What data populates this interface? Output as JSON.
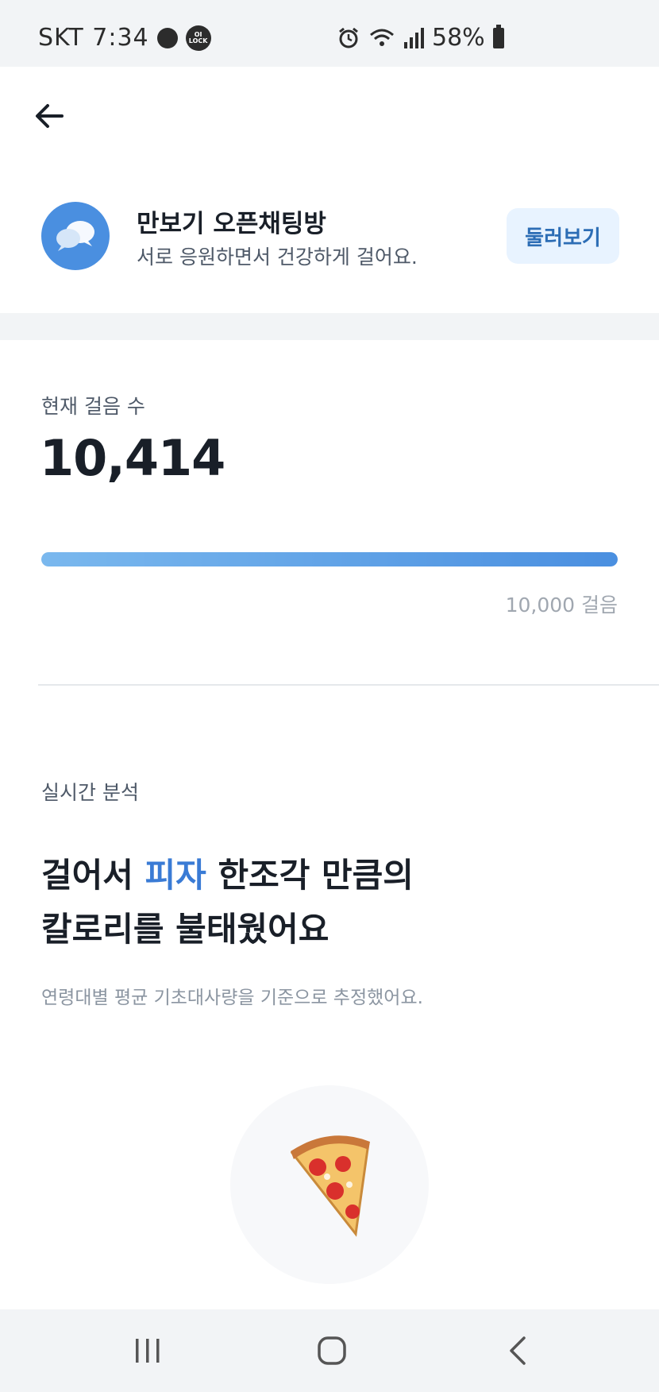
{
  "status_bar": {
    "carrier_time": "SKT 7:34",
    "lock_badge": "OI LOCK",
    "battery_percent": "58%",
    "icons": [
      "chat-bubble-icon",
      "lock-badge-icon",
      "alarm-icon",
      "wifi-icon",
      "signal-icon",
      "battery-icon"
    ]
  },
  "header": {
    "back_icon": "arrow-left-icon"
  },
  "chat_room": {
    "title": "만보기 오픈채팅방",
    "subtitle": "서로 응원하면서 건강하게 걸어요.",
    "button_label": "둘러보기",
    "icon": "chat-bubbles-icon"
  },
  "steps": {
    "label": "현재 걸음 수",
    "value": "10,414",
    "goal_label": "10,000 걸음",
    "progress": 1.0
  },
  "analysis": {
    "label": "실시간 분석",
    "headline_prefix": "걸어서 ",
    "headline_accent": "피자",
    "headline_suffix": " 한조각 만큼의",
    "headline_line2": "칼로리를 불태웠어요",
    "note": "연령대별 평균 기초대사량을 기준으로 추정했어요.",
    "food_icon": "pizza-slice-icon"
  },
  "nav_bar": {
    "icons": [
      "recent-apps-icon",
      "home-icon",
      "back-icon"
    ]
  },
  "colors": {
    "accent": "#3a7bd5",
    "progress_start": "#7ab8ee",
    "progress_end": "#4a8fe0",
    "chat_avatar": "#4a8fe0",
    "browse_button_bg": "#e8f3ff"
  }
}
